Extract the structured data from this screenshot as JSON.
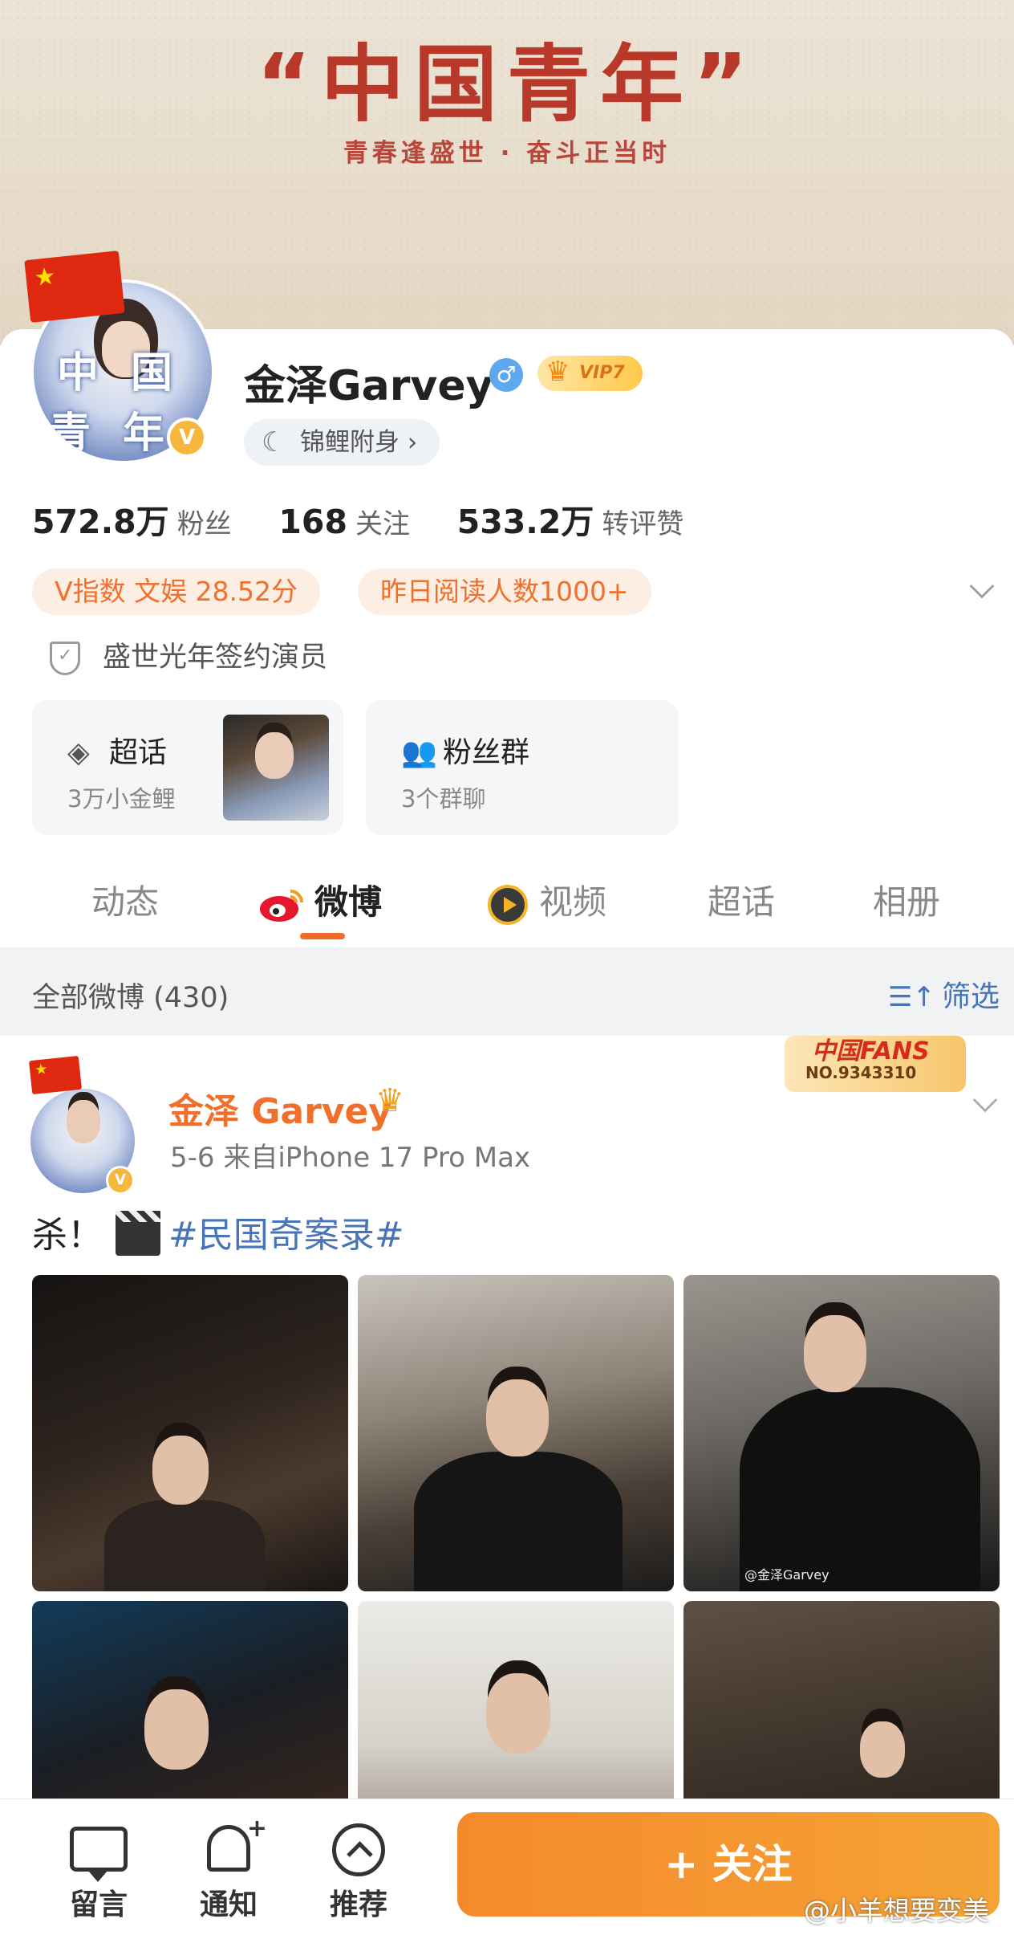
{
  "banner": {
    "title": "“中国青年”",
    "subtitle": "青春逢盛世 · 奋斗正当时"
  },
  "profile": {
    "name": "金泽Garvey",
    "gender_symbol": "♂",
    "vip_label": "VIP7",
    "koi_label": "锦鲤附身 ›",
    "avatar_text": "中国青年",
    "stats": [
      {
        "value": "572.8万",
        "label": "粉丝"
      },
      {
        "value": "168",
        "label": "关注"
      },
      {
        "value": "533.2万",
        "label": "转评赞"
      }
    ],
    "tags": [
      "V指数 文娱 28.52分",
      "昨日阅读人数1000+"
    ],
    "signing": "盛世光年签约演员",
    "boxes": [
      {
        "title": "超话",
        "subtitle": "3万小金鲤",
        "icon": "diamond-icon"
      },
      {
        "title": "粉丝群",
        "subtitle": "3个群聊",
        "icon": "people-icon"
      }
    ]
  },
  "tabs": [
    {
      "label": "动态",
      "active": false
    },
    {
      "label": "微博",
      "active": true,
      "icon": "weibo-logo-icon"
    },
    {
      "label": "视频",
      "active": false,
      "icon": "video-icon"
    },
    {
      "label": "超话",
      "active": false
    },
    {
      "label": "相册",
      "active": false
    }
  ],
  "filter": {
    "count_label": "全部微博 (430)",
    "filter_label": "筛选"
  },
  "post": {
    "author": "金泽 Garvey",
    "meta": "5-6  来自iPhone 17 Pro Max",
    "text_prefix": "杀！",
    "hashtag": "#民国奇案录#",
    "fans_badge_title": "中国FANS",
    "fans_badge_no": "NO.9343310",
    "photo_watermark": "@金泽Garvey",
    "photo_count": 6
  },
  "bottom_bar": {
    "items": [
      {
        "label": "留言",
        "icon": "comment-icon"
      },
      {
        "label": "通知",
        "icon": "bell-plus-icon"
      },
      {
        "label": "推荐",
        "icon": "arrow-up-circle-icon"
      }
    ],
    "follow_label": "+ 关注",
    "watermark": "@小羊想要变美"
  },
  "colors": {
    "accent_orange": "#f06f2b",
    "link_blue": "#4775b8",
    "banner_red": "#b8392a",
    "follow_button": "#f58a2d"
  }
}
